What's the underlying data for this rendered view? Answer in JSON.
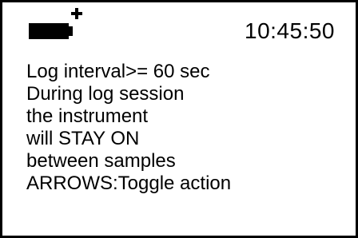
{
  "status_bar": {
    "battery_icon": "battery-full-icon",
    "charging_icon": "plus-icon",
    "time": "10:45:50"
  },
  "message": {
    "lines": [
      "Log interval>= 60 sec",
      "During log session",
      "the instrument",
      "will STAY ON",
      "between samples",
      "ARROWS:Toggle action"
    ]
  },
  "colors": {
    "foreground": "#000000",
    "background": "#ffffff"
  }
}
